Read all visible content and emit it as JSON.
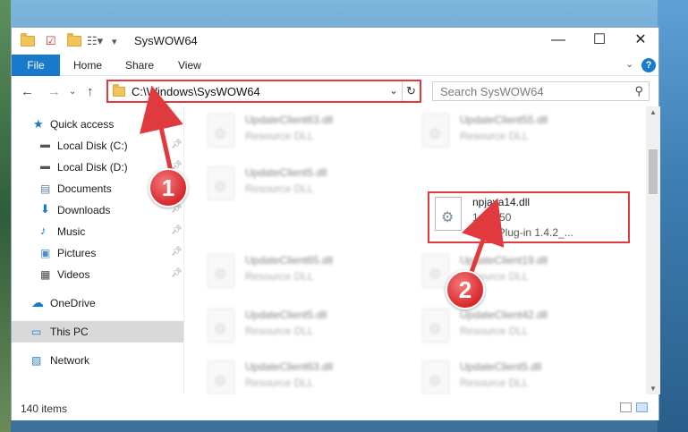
{
  "window": {
    "title": "SysWOW64",
    "controls": {
      "minimize": "—",
      "maximize": "☐",
      "close": "✕"
    }
  },
  "ribbon": {
    "file_label": "File",
    "tabs": [
      "Home",
      "Share",
      "View"
    ]
  },
  "address": {
    "path": "C:\\Windows\\SysWOW64",
    "search_placeholder": "Search SysWOW64"
  },
  "sidebar": {
    "items": [
      {
        "label": "Quick access",
        "icon": "star-icon",
        "pinned": false
      },
      {
        "label": "Local Disk (C:)",
        "icon": "drive-icon",
        "pinned": true
      },
      {
        "label": "Local Disk (D:)",
        "icon": "drive-icon",
        "pinned": true
      },
      {
        "label": "Documents",
        "icon": "documents-icon",
        "pinned": true
      },
      {
        "label": "Downloads",
        "icon": "download-icon",
        "pinned": true
      },
      {
        "label": "Music",
        "icon": "music-icon",
        "pinned": true
      },
      {
        "label": "Pictures",
        "icon": "pictures-icon",
        "pinned": true
      },
      {
        "label": "Videos",
        "icon": "videos-icon",
        "pinned": true
      },
      {
        "label": "OneDrive",
        "icon": "cloud-icon",
        "pinned": false
      },
      {
        "label": "This PC",
        "icon": "computer-icon",
        "pinned": false,
        "selected": true
      },
      {
        "label": "Network",
        "icon": "network-icon",
        "pinned": false
      }
    ]
  },
  "files": [
    {
      "name": "UpdateClient63.dll",
      "type": "Resource DLL"
    },
    {
      "name": "UpdateClient55.dll",
      "type": "Resource DLL"
    },
    {
      "name": "UpdateClient5.dll",
      "type": "Resource DLL"
    },
    {
      "name": "npjava14.dll",
      "version": "1.4.2.50",
      "type": "Java Plug-in 1.4.2_...",
      "highlighted": true
    },
    {
      "name": "UpdateClient65.dll",
      "type": "Resource DLL"
    },
    {
      "name": "UpdateClient19.dll",
      "type": "Resource DLL"
    },
    {
      "name": "UpdateClient5.dll",
      "type": "Resource DLL"
    },
    {
      "name": "UpdateClient42.dll",
      "type": "Resource DLL"
    },
    {
      "name": "UpdateClient63.dll",
      "type": "Resource DLL"
    },
    {
      "name": "UpdateClient5.dll",
      "type": "Resource DLL"
    }
  ],
  "status": {
    "item_count": "140 items"
  },
  "annotations": {
    "badge1": "1",
    "badge2": "2"
  },
  "colors": {
    "accent": "#1979ca",
    "highlight": "#e0393e",
    "selection": "#d9d9d9"
  }
}
